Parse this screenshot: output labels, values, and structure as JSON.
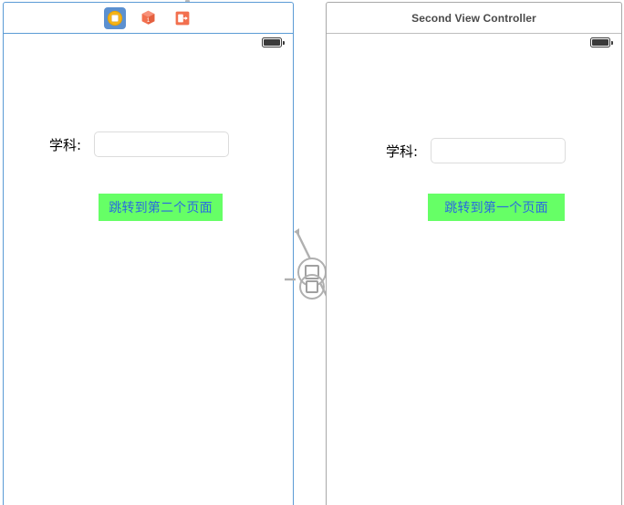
{
  "canvas": {
    "accent_selected": "#5b9bd5",
    "accent_unselected": "#a8a8a8",
    "button_green": "#66ff66",
    "button_text_blue": "#2a6ae0"
  },
  "scenes": [
    {
      "id": "first-view-controller",
      "selected": true,
      "dock": {
        "title": "",
        "icons": [
          {
            "name": "view-controller-icon",
            "label": "View Controller",
            "active": true
          },
          {
            "name": "first-responder-icon",
            "label": "First Responder",
            "active": false
          },
          {
            "name": "exit-icon",
            "label": "Exit",
            "active": false
          }
        ]
      },
      "status_bar": {
        "battery_label": "battery-icon"
      },
      "form": {
        "label": "学科:",
        "field_value": "",
        "field_placeholder": ""
      },
      "button_label": "跳转到第二个页面"
    },
    {
      "id": "second-view-controller",
      "selected": false,
      "dock": {
        "title": "Second View Controller",
        "icons": []
      },
      "status_bar": {
        "battery_label": "battery-icon"
      },
      "form": {
        "label": "学科:",
        "field_value": "",
        "field_placeholder": ""
      },
      "button_label": "跳转到第一个页面"
    }
  ],
  "segue": {
    "name": "modal-segue-connector",
    "badge": "present-modally-icon"
  }
}
